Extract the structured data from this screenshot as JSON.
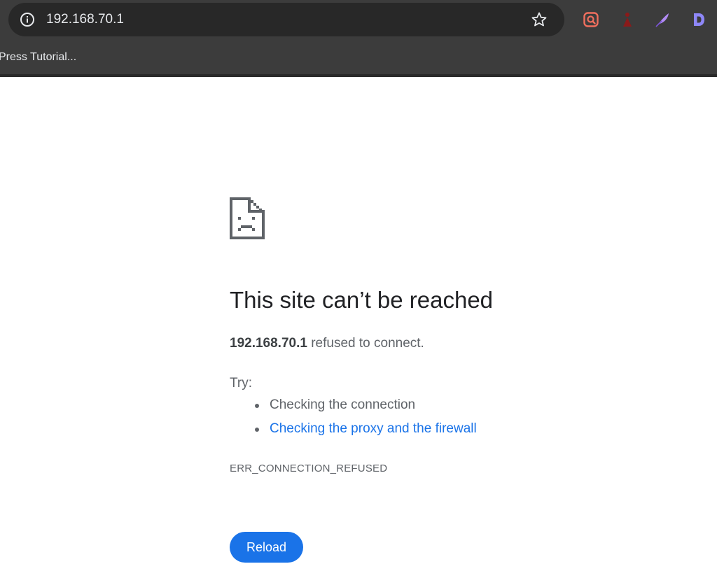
{
  "toolbar": {
    "url": "192.168.70.1",
    "site_info_icon": "info-icon",
    "bookmark_star_icon": "star-outline-icon",
    "extensions": [
      {
        "name": "screen-search-extension-icon",
        "color": "#f06f5e"
      },
      {
        "name": "person-extension-icon",
        "color": "#8b1a1a"
      },
      {
        "name": "feather-extension-icon",
        "color": "#b28cf5"
      },
      {
        "name": "d-extension-icon",
        "color": "#8e87f8"
      }
    ]
  },
  "bookmarks_bar": {
    "items": [
      {
        "label": "Press Tutorial..."
      }
    ]
  },
  "error_page": {
    "icon": "sad-document-icon",
    "title": "This site can’t be reached",
    "host": "192.168.70.1",
    "message": " refused to connect.",
    "try_label": "Try:",
    "suggestions": [
      {
        "label": "Checking the connection",
        "is_link": false
      },
      {
        "label": "Checking the proxy and the firewall",
        "is_link": true
      }
    ],
    "error_code": "ERR_CONNECTION_REFUSED",
    "reload_label": "Reload"
  },
  "colors": {
    "chrome_bg": "#3c3c3c",
    "omnibox_bg": "#282828",
    "accent": "#1a73e8",
    "heading": "#202124",
    "body_text": "#5f6368"
  }
}
